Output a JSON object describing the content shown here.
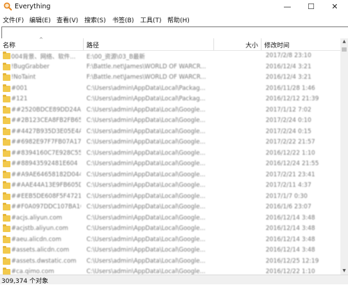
{
  "window": {
    "title": "Everything",
    "icon": "magnifier-icon",
    "controls": {
      "minimize": "—",
      "maximize": "☐",
      "close": "✕"
    }
  },
  "menu": [
    "文件(F)",
    "编辑(E)",
    "查看(V)",
    "搜索(S)",
    "书签(B)",
    "工具(T)",
    "帮助(H)"
  ],
  "search": {
    "value": "",
    "placeholder": ""
  },
  "columns": {
    "name": "名称",
    "path": "路径",
    "size": "大小",
    "modified": "修改时间",
    "sort_indicator": "^"
  },
  "rows": [
    {
      "name": "004背景、网络、软件...",
      "path": "E:\\00_资源\\03_B最新",
      "date": "2017/2/8 23:10"
    },
    {
      "name": "!BugGrabber",
      "path": "F:\\Battle.net\\James\\WORLD OF WARCR...",
      "date": "2016/12/4 3:21"
    },
    {
      "name": "!NoTaint",
      "path": "F:\\Battle.net\\James\\WORLD OF WARCR...",
      "date": "2016/12/4 3:21"
    },
    {
      "name": "#001",
      "path": "C:\\Users\\admin\\AppData\\Local\\Packag...",
      "date": "2016/11/28 1:46"
    },
    {
      "name": "#121",
      "path": "C:\\Users\\admin\\AppData\\Local\\Packag...",
      "date": "2016/12/12 21:39"
    },
    {
      "name": "##2520BDCE89DD24A1",
      "path": "C:\\Users\\admin\\AppData\\Local\\Google...",
      "date": "2017/1/12 7:02"
    },
    {
      "name": "##2B123CEA8FB2FB65",
      "path": "C:\\Users\\admin\\AppData\\Local\\Google...",
      "date": "2017/2/24 0:10"
    },
    {
      "name": "##4427B935D3E05E4A",
      "path": "C:\\Users\\admin\\AppData\\Local\\Google...",
      "date": "2017/2/24 0:15"
    },
    {
      "name": "##6982E97F7FB07A17",
      "path": "C:\\Users\\admin\\AppData\\Local\\Google...",
      "date": "2017/2/22 21:57"
    },
    {
      "name": "##8394160C7E928C55",
      "path": "C:\\Users\\admin\\AppData\\Local\\Google...",
      "date": "2016/12/22 1:10"
    },
    {
      "name": "##88943592481E604",
      "path": "C:\\Users\\admin\\AppData\\Local\\Google...",
      "date": "2016/12/24 21:55"
    },
    {
      "name": "##A9AE64658182D044",
      "path": "C:\\Users\\admin\\AppData\\Local\\Google...",
      "date": "2017/2/21 23:41"
    },
    {
      "name": "##AAE44A13E9FB605D",
      "path": "C:\\Users\\admin\\AppData\\Local\\Google...",
      "date": "2017/2/11 4:37"
    },
    {
      "name": "##EEB5DE608F5F4721",
      "path": "C:\\Users\\admin\\AppData\\Local\\Google...",
      "date": "2017/1/7 0:30"
    },
    {
      "name": "##F0A097DDC107BA10",
      "path": "C:\\Users\\admin\\AppData\\Local\\Google...",
      "date": "2016/1/6 23:07"
    },
    {
      "name": "#acjs.aliyun.com",
      "path": "C:\\Users\\admin\\AppData\\Local\\Google...",
      "date": "2016/12/14 3:48"
    },
    {
      "name": "#acjstb.aliyun.com",
      "path": "C:\\Users\\admin\\AppData\\Local\\Google...",
      "date": "2016/12/14 3:48"
    },
    {
      "name": "#aeu.alicdn.com",
      "path": "C:\\Users\\admin\\AppData\\Local\\Google...",
      "date": "2016/12/14 3:48"
    },
    {
      "name": "#assets.alicdn.com",
      "path": "C:\\Users\\admin\\AppData\\Local\\Google...",
      "date": "2016/12/14 3:48"
    },
    {
      "name": "#assets.dwstatic.com",
      "path": "C:\\Users\\admin\\AppData\\Local\\Google...",
      "date": "2016/12/25 12:19"
    },
    {
      "name": "#ca.qimo.com",
      "path": "C:\\Users\\admin\\AppData\\Local\\Google...",
      "date": "2016/12/22 1:10"
    }
  ],
  "status": {
    "text": "309,374 个对象"
  }
}
